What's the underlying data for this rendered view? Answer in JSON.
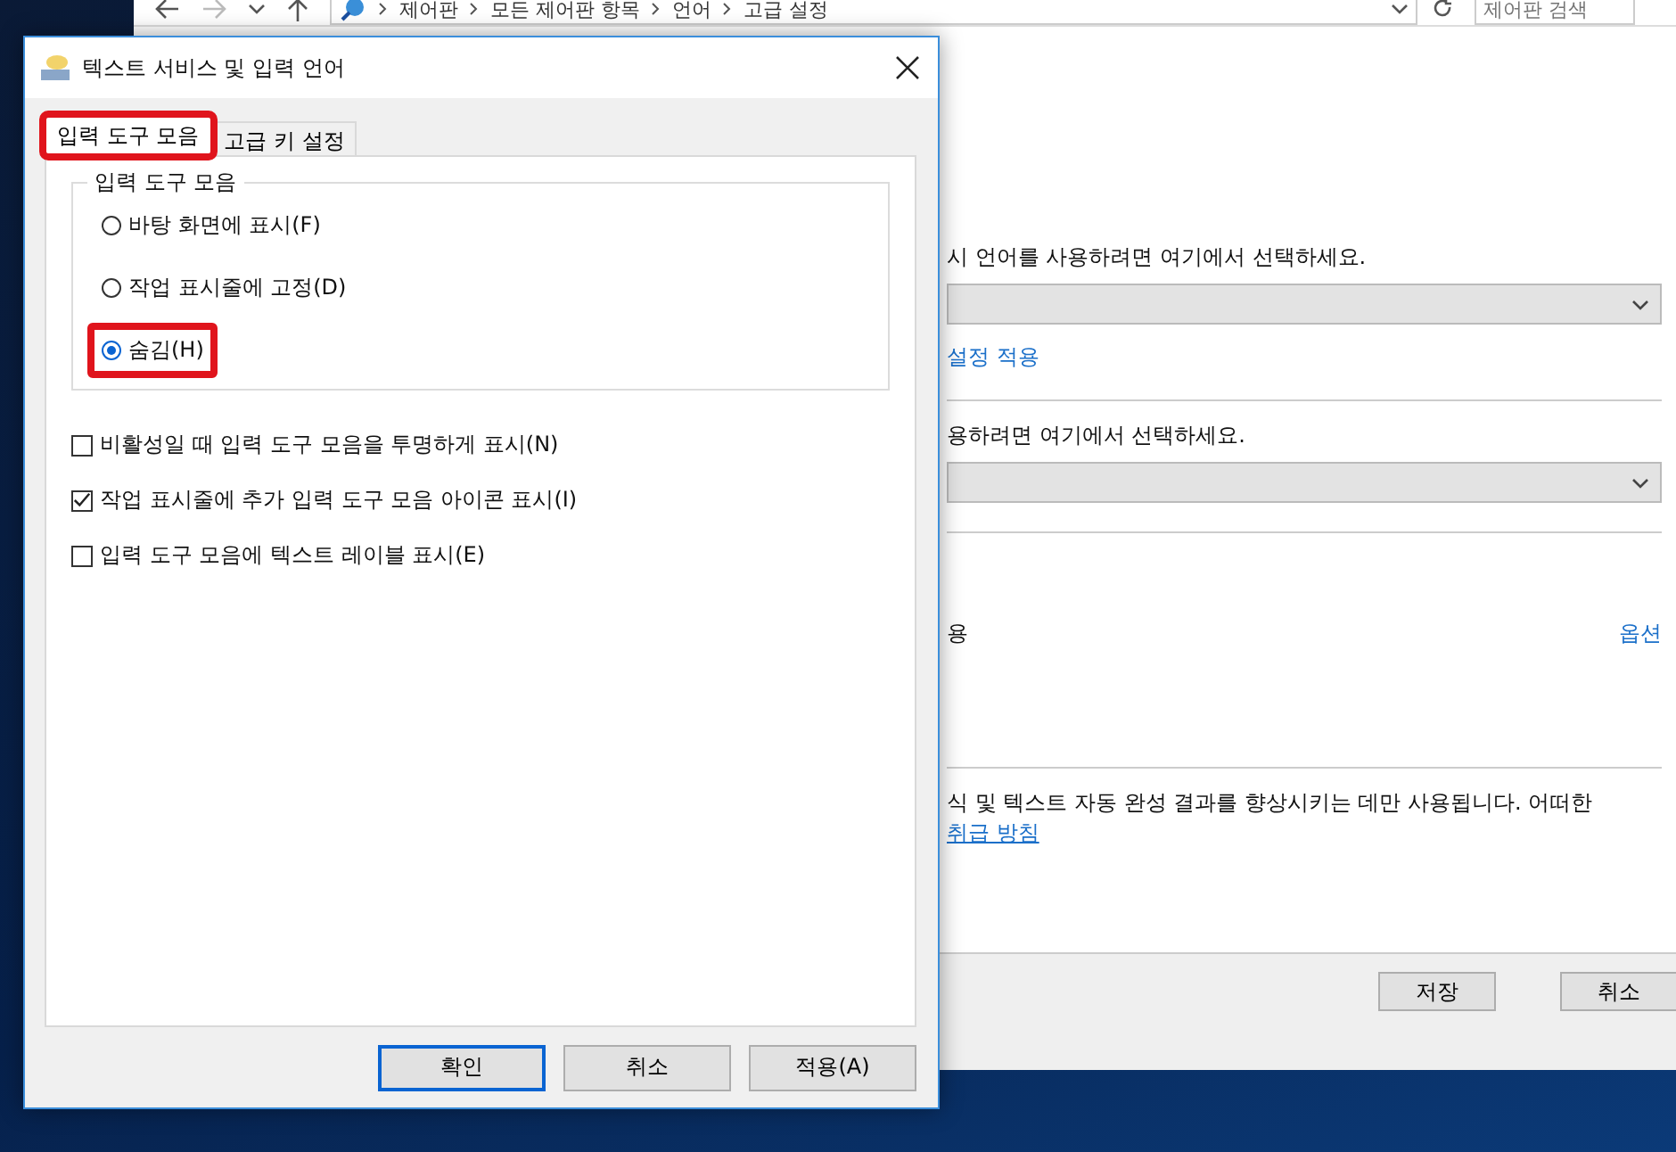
{
  "background_window": {
    "breadcrumb": [
      "제어판",
      "모든 제어판 항목",
      "언어",
      "고급 설정"
    ],
    "search": {
      "placeholder": "제어판 검색"
    },
    "content": [
      {
        "kind": "text",
        "text": "시 언어를 사용하려면 여기에서 선택하세요."
      },
      {
        "kind": "dropdown"
      },
      {
        "kind": "link",
        "text": "설정 적용"
      },
      {
        "kind": "divider"
      },
      {
        "kind": "text",
        "text": "용하려면 여기에서 선택하세요."
      },
      {
        "kind": "dropdown"
      },
      {
        "kind": "divider"
      },
      {
        "kind": "option_row",
        "text": "용",
        "link": "옵션"
      },
      {
        "kind": "divider"
      },
      {
        "kind": "text",
        "text": "식 및 텍스트 자동 완성 결과를 향상시키는 데만 사용됩니다. 어떠한"
      },
      {
        "kind": "link",
        "text": "취급 방침"
      }
    ],
    "buttons": [
      "저장",
      "취소"
    ]
  },
  "dialog": {
    "title": "텍스트 서비스 및 입력 언어",
    "tabs": [
      {
        "label": "입력 도구 모음",
        "selected": true,
        "highlighted": true
      },
      {
        "label": "고급 키 설정",
        "selected": false,
        "highlighted": false
      }
    ],
    "group": {
      "title": "입력 도구 모음",
      "options": [
        {
          "label": "바탕 화면에 표시(F)",
          "selected": false,
          "highlighted": false
        },
        {
          "label": "작업 표시줄에 고정(D)",
          "selected": false,
          "highlighted": false
        },
        {
          "label": "숨김(H)",
          "selected": true,
          "highlighted": true
        }
      ]
    },
    "checkboxes": [
      {
        "label": "비활성일 때 입력 도구 모음을 투명하게 표시(N)",
        "checked": false
      },
      {
        "label": "작업 표시줄에 추가 입력 도구 모음 아이콘 표시(I)",
        "checked": true
      },
      {
        "label": "입력 도구 모음에 텍스트 레이블 표시(E)",
        "checked": false
      }
    ],
    "buttons": [
      {
        "label": "확인",
        "default": true
      },
      {
        "label": "취소",
        "default": false
      },
      {
        "label": "적용(A)",
        "default": false
      }
    ]
  }
}
